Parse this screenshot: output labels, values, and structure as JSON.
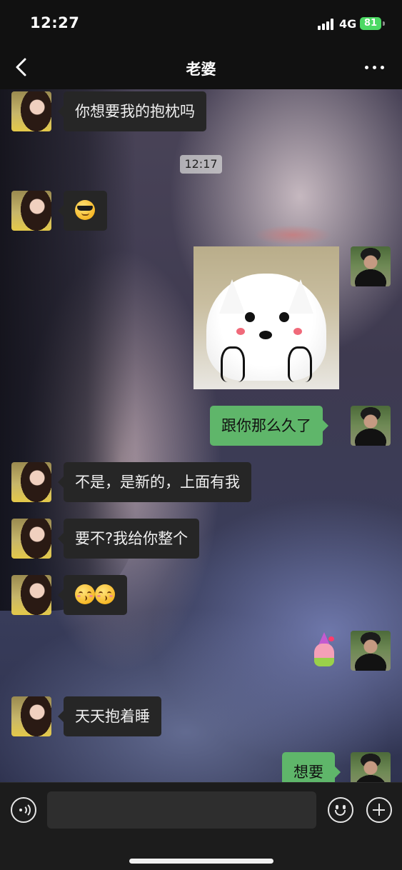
{
  "status_bar": {
    "time": "12:27",
    "network": "4G",
    "battery": "81",
    "battery_color": "#4cd964"
  },
  "nav": {
    "title": "老婆",
    "back_icon": "chevron-left-icon",
    "more_icon": "more-dots-icon"
  },
  "timestamp": "12:17",
  "messages": [
    {
      "from": "her",
      "type": "text",
      "text": "你想要我的抱枕吗"
    },
    {
      "from": "her",
      "type": "emoji",
      "emoji": "sunglasses-smirk-emoji"
    },
    {
      "from": "me",
      "type": "sticker",
      "sticker": "white-dog-sticker"
    },
    {
      "from": "me",
      "type": "text",
      "text": "跟你那么久了"
    },
    {
      "from": "her",
      "type": "text",
      "text": "不是，是新的，上面有我"
    },
    {
      "from": "her",
      "type": "text",
      "text": "要不?我给你整个"
    },
    {
      "from": "her",
      "type": "emoji",
      "emoji": "kissing-face-emoji-x2"
    },
    {
      "from": "me",
      "type": "sticker",
      "sticker": "starfish-sticker"
    },
    {
      "from": "her",
      "type": "text",
      "text": "天天抱着睡"
    },
    {
      "from": "me",
      "type": "text",
      "text": "想要"
    }
  ],
  "input_bar": {
    "value": "",
    "voice_icon": "voice-icon",
    "emoji_icon": "emoji-icon",
    "plus_icon": "plus-icon"
  },
  "colors": {
    "outgoing_bubble": "#5fb66a",
    "incoming_bubble": "#262626",
    "bar_background": "#111111"
  }
}
